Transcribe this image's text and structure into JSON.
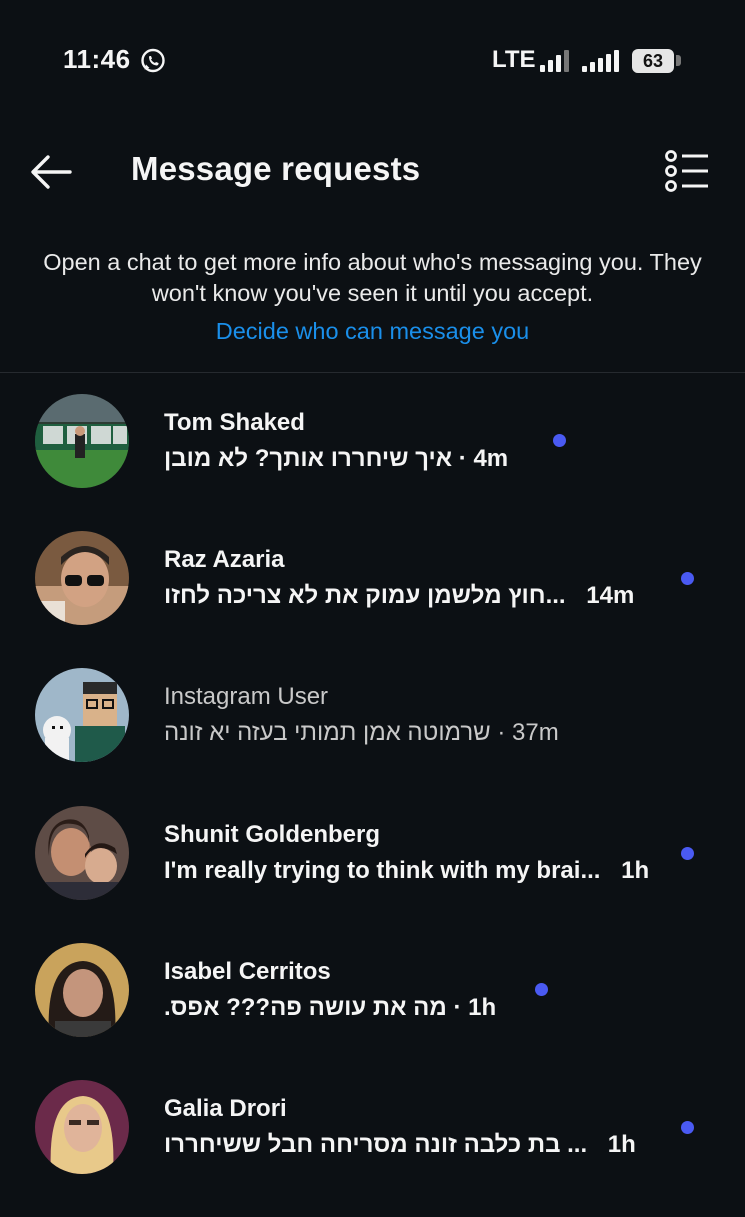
{
  "status_bar": {
    "time": "11:46",
    "network": "LTE",
    "battery": "63"
  },
  "header": {
    "title": "Message requests"
  },
  "info": {
    "text": "Open a chat to get more info about who's messaging you. They won't know you've seen it until you accept.",
    "link": "Decide who can message you"
  },
  "requests": [
    {
      "name": "Tom Shaked",
      "preview": "איך שיחררו אותך? לא מובן",
      "time": "· 4m",
      "unread": true
    },
    {
      "name": "Raz Azaria",
      "preview": "...חוץ מלשמן עמוק את לא צריכה לחזו",
      "time": "14m",
      "unread": true
    },
    {
      "name": "Instagram User",
      "preview": "שרמוטה אמן תמותי בעזה יא זונה",
      "time": "· 37m",
      "unread": false
    },
    {
      "name": "Shunit Goldenberg",
      "preview": "I'm really trying to think with my brai...",
      "time": "1h",
      "unread": true
    },
    {
      "name": "Isabel Cerritos",
      "preview": "מה את עושה פה??? אפס.",
      "time": "· 1h",
      "unread": true
    },
    {
      "name": "Galia Drori",
      "preview": "... בת כלבה זונה מסריחה חבל ששיחררו",
      "time": "1h",
      "unread": true
    }
  ],
  "colors": {
    "background": "#0c1014",
    "link": "#1a8fea",
    "unread_dot": "#4a5af2"
  },
  "icons": [
    "whatsapp-icon",
    "signal-icon",
    "battery-icon",
    "back-arrow-icon",
    "list-filter-icon"
  ]
}
